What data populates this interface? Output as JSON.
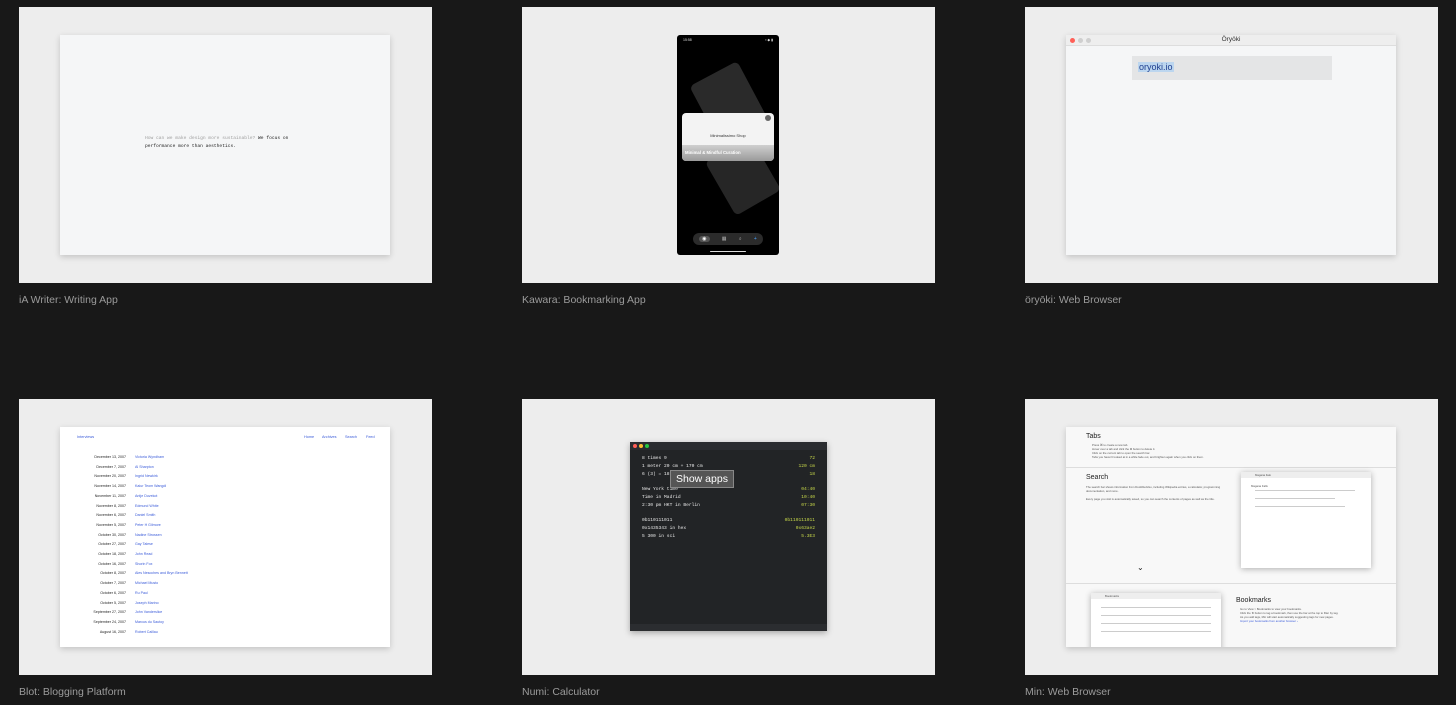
{
  "cards": [
    {
      "caption": "iA Writer: Writing App"
    },
    {
      "caption": "Kawara: Bookmarking App"
    },
    {
      "caption": "öryōki: Web Browser"
    },
    {
      "caption": "Blot: Blogging Platform"
    },
    {
      "caption": "Numi: Calculator"
    },
    {
      "caption": "Min: Web Browser"
    }
  ],
  "ia": {
    "question": "How can we make design more sustainable?",
    "answer_a": "We focus on",
    "answer_b": "performance more than aesthetics."
  },
  "kawara": {
    "time": "15:58",
    "signal": "▪ ◆ ▮",
    "shop": "Minimalissimo Shop",
    "curation": "Minimal & Mindful Curation",
    "tabs": [
      "◉",
      "▦",
      "⌕",
      "+"
    ]
  },
  "oryoki": {
    "title": "Öryöki",
    "url": "oryoki.io"
  },
  "blot": {
    "brand": "Interviews",
    "nav": [
      "Home",
      "Archives",
      "Search",
      "Feed"
    ],
    "entries": [
      {
        "date": "December 13, 2007",
        "name": "Victoria Wyndham"
      },
      {
        "date": "December 7, 2007",
        "name": "Al Sharpton"
      },
      {
        "date": "November 20, 2007",
        "name": "Ingrid Newkirk"
      },
      {
        "date": "November 14, 2007",
        "name": "Kaiur Teom Wangdi"
      },
      {
        "date": "November 11, 2007",
        "name": "Antje Duvekot"
      },
      {
        "date": "November 8, 2007",
        "name": "Edmund White"
      },
      {
        "date": "November 6, 2007",
        "name": "Daniel Smith"
      },
      {
        "date": "November 5, 2007",
        "name": "Peter H Gilmore"
      },
      {
        "date": "October 30, 2007",
        "name": "Nadine Strossen"
      },
      {
        "date": "October 27, 2007",
        "name": "Gay Talese"
      },
      {
        "date": "October 18, 2007",
        "name": "John Read"
      },
      {
        "date": "October 16, 2007",
        "name": "Shorin Fox"
      },
      {
        "date": "October 8, 2007",
        "name": "Ales Nesoches and Bryn Bennett"
      },
      {
        "date": "October 7, 2007",
        "name": "Michael Musto"
      },
      {
        "date": "October 6, 2007",
        "name": "Ru Paul"
      },
      {
        "date": "October 5, 2007",
        "name": "Joseph Marino"
      },
      {
        "date": "September 27, 2007",
        "name": "John Vanderslice"
      },
      {
        "date": "September 24, 2007",
        "name": "Marcus du Sautoy"
      },
      {
        "date": "August 16, 2007",
        "name": "Robert Caillau"
      }
    ]
  },
  "numi": {
    "lines": [
      {
        "expr": "8 times 9",
        "res": "72"
      },
      {
        "expr": "1 meter 20 cm + 170 cm",
        "res": "120 cm"
      },
      {
        "expr": "6 (3) = 18",
        "res": "18"
      },
      {
        "expr": "",
        "res": ""
      },
      {
        "expr": "New York time",
        "res": "04:40"
      },
      {
        "expr": "Time in Madrid",
        "res": "10:40"
      },
      {
        "expr": "2:30 pm HKT in Berlin",
        "res": "07:30"
      },
      {
        "expr": "",
        "res": ""
      },
      {
        "expr": "0b110111011",
        "res": "0b110111011"
      },
      {
        "expr": "0x1435343 in hex",
        "res": "0x63ae2"
      },
      {
        "expr": "5 300 in sci",
        "res": "5.3E3"
      }
    ],
    "tooltip": "Show apps"
  },
  "min": {
    "tabs_heading": "Tabs",
    "tabs_lines": [
      "Press ⌘ to create a new tab.",
      "Hover over a tab and click the ⊗ button to delete it.",
      "Click on the current tab to open the search bar.",
      "Tabs you haven't looked at in a while fade out, and brighten again when you click on them."
    ],
    "search_heading": "Search",
    "search_text": "The search bar shows information from DuckDuckGo, including Wikipedia entries, a calculator, programming documentation, and more.",
    "search_text2": "Every page you visit is automatically saved, so you can search the contents of pages as well as the title.",
    "win_title": "Magana Ilalo",
    "win_result": "Magana Falls",
    "chevron": "⌄",
    "bookmarks_heading": "Bookmarks",
    "bookmarks_lines": [
      "Go to View > Bookmarks to view your bookmarks.",
      "Click the ★ button to tag a bookmark, then use the bar at the top to filter by tag.",
      "As you add tags, Min will start automatically suggesting tags for new pages."
    ],
    "bookmarks_link": "Import your bookmarks from another browser ›",
    "bm_win_title": "Bookmarks"
  }
}
